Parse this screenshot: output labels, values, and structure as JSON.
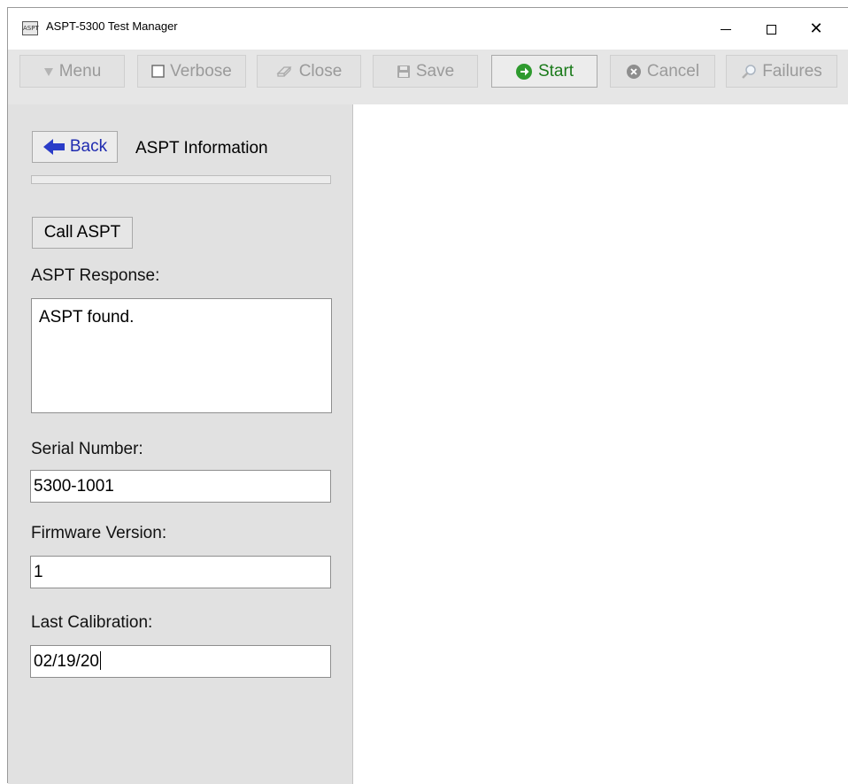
{
  "window": {
    "title": "ASPT-5300 Test Manager",
    "app_icon_text": "ASPT"
  },
  "toolbar": {
    "menu_label": "Menu",
    "verbose_label": "Verbose",
    "verbose_checked": false,
    "close_label": "Close",
    "save_label": "Save",
    "start_label": "Start",
    "cancel_label": "Cancel",
    "failures_label": "Failures"
  },
  "panel": {
    "back_label": "Back",
    "section_title": "ASPT Information",
    "progress_fraction": 0.0,
    "call_button_label": "Call ASPT",
    "response_label": "ASPT Response:",
    "response_text": "ASPT found.",
    "serial_label": "Serial Number:",
    "serial_value": "5300-1001",
    "firmware_label": "Firmware Version:",
    "firmware_value": "1",
    "calibration_label": "Last Calibration:",
    "calibration_value": "02/19/20"
  },
  "colors": {
    "start_green": "#1a7a1a",
    "back_blue": "#1f2bb0",
    "disabled_gray": "#9a9a9a"
  },
  "icons": {
    "menu": "triangle-down-icon",
    "verbose": "checkbox-icon",
    "close": "eraser-icon",
    "save": "floppy-icon",
    "start": "play-circle-icon",
    "cancel": "x-circle-icon",
    "failures": "magnifier-icon",
    "back": "left-arrow-icon"
  }
}
